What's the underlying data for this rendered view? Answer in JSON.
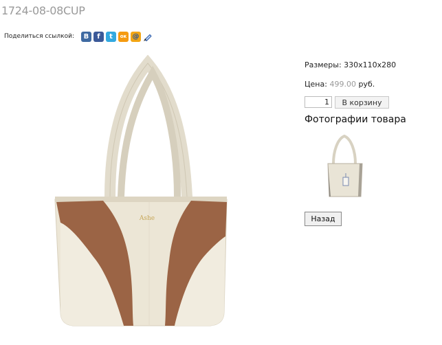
{
  "product": {
    "title": "1724-08-08CUP",
    "brand_mark": "Ashe"
  },
  "share": {
    "label": "Поделиться ссылкой:",
    "icons": [
      "vk-icon",
      "facebook-icon",
      "twitter-icon",
      "odnoklassniki-icon",
      "mailru-icon",
      "livejournal-icon"
    ],
    "vk_glyph": "В",
    "fb_glyph": "f",
    "tw_glyph": "t",
    "ok_glyph": "ок",
    "mail_glyph": "@"
  },
  "details": {
    "size_text": "Размеры: 330x110x280",
    "price_label": "Цена: ",
    "price_value": "499.00",
    "price_currency": " руб.",
    "quantity": "1",
    "cart_button": "В корзину",
    "photos_heading": "Фотографии товара",
    "back_button": "Назад"
  },
  "colors": {
    "bag_cream": "#ece6d6",
    "bag_brown": "#9b6445",
    "title_grey": "#9a9a9a",
    "price_grey": "#999999"
  }
}
